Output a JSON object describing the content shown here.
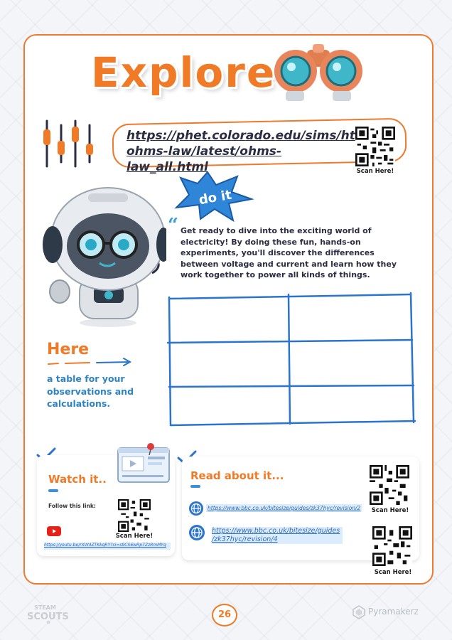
{
  "header": {
    "title": "Explore"
  },
  "main_link": {
    "url_line1": "https://phet.colorado.edu/sims/html/",
    "url_line2": "ohms-law/latest/ohms-law_all.html",
    "scan_label": "Scan Here!"
  },
  "doit_badge": "do it",
  "intro_text": "Get ready to dive into the exciting world of electricity! By doing these fun, hands-on experiments, you'll discover the differences between voltage and current and learn how they work together to power all kinds of things.",
  "table": {
    "rows": 3,
    "cols": 2
  },
  "here": {
    "title": "Here",
    "subtitle": "a table for your observations and calculations."
  },
  "watch": {
    "title": "Watch it..",
    "follow_label": "Follow this link:",
    "scan_label": "Scan Here!",
    "link": "https://youtu.be/rXW4ZTKkqRY?si=s9CS6wRp7ZzRmMYg",
    "icon": "youtube-icon"
  },
  "read": {
    "title": "Read about it...",
    "link1": "https://www.bbc.co.uk/bitesize/guides/zk37hyc/revision/2",
    "link2_line1": "https://www.bbc.co.uk/bitesize/guides",
    "link2_line2": "/zk37hyc/revision/4",
    "scan_label_1": "Scan Here!",
    "scan_label_2": "Scan Here!"
  },
  "footer": {
    "page_number": "26",
    "left_logo_line1": "STEAM",
    "left_logo_line2": "SCOUTS",
    "right_logo": "Pyramakerz"
  },
  "colors": {
    "accent": "#f07a26",
    "blue": "#2d83c4",
    "text": "#2b2d42"
  }
}
